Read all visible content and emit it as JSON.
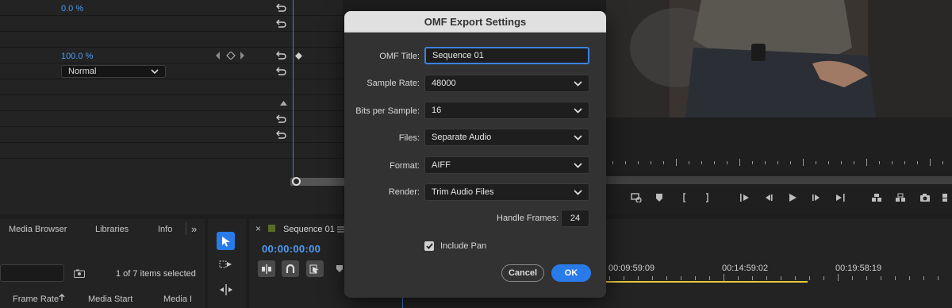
{
  "effect_controls": {
    "opacity_value": "0.0 %",
    "scale_value": "100.0 %",
    "blend_mode": "Normal"
  },
  "program_monitor": {
    "transport_icons": [
      "marker-icon",
      "in-point-icon",
      "out-point-icon",
      "go-to-in-icon",
      "step-back-icon",
      "play-icon",
      "step-forward-icon",
      "go-to-out-icon",
      "lift-icon",
      "extract-icon",
      "export-frame-icon"
    ]
  },
  "project_panel": {
    "tabs": [
      "Media Browser",
      "Libraries",
      "Info"
    ],
    "overflow": "»",
    "items_selected": "1 of 7 items selected",
    "columns": [
      "Frame Rate",
      "Media Start",
      "Media I"
    ]
  },
  "sequence_panel": {
    "title": "Sequence 01",
    "timecode": "00:00:00:00",
    "ruler_labels": [
      "00:09:59:09",
      "00:14:59:02",
      "00:19:58:19"
    ]
  },
  "dialog": {
    "title": "OMF Export Settings",
    "omf_title_label": "OMF Title:",
    "omf_title_value": "Sequence 01",
    "sample_rate_label": "Sample Rate:",
    "sample_rate_value": "48000",
    "bits_label": "Bits per Sample:",
    "bits_value": "16",
    "files_label": "Files:",
    "files_value": "Separate Audio",
    "format_label": "Format:",
    "format_value": "AIFF",
    "render_label": "Render:",
    "render_value": "Trim Audio Files",
    "handle_frames_label": "Handle Frames:",
    "handle_frames_value": "24",
    "include_pan_label": "Include Pan",
    "include_pan_checked": true,
    "cancel_label": "Cancel",
    "ok_label": "OK"
  },
  "colors": {
    "accent_blue": "#2a7bea",
    "timecode_blue": "#4f9cf4",
    "work_area_yellow": "#e6c93a"
  }
}
